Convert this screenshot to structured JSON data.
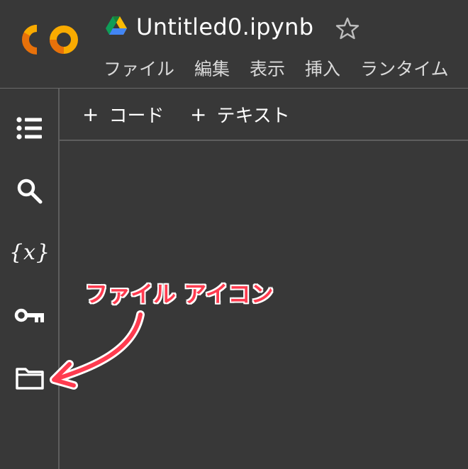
{
  "header": {
    "title": "Untitled0.ipynb",
    "logo_text": "CO",
    "icons": [
      "colab-logo",
      "google-drive-icon",
      "star-icon"
    ],
    "menu": [
      {
        "label": "ファイル"
      },
      {
        "label": "編集"
      },
      {
        "label": "表示"
      },
      {
        "label": "挿入"
      },
      {
        "label": "ランタイム"
      }
    ]
  },
  "toolbar": {
    "add_code_label": "コード",
    "add_text_label": "テキスト",
    "plus_symbol": "+"
  },
  "sidebar": {
    "items": [
      {
        "name": "table-of-contents",
        "icon": "list-icon"
      },
      {
        "name": "search",
        "icon": "search-icon"
      },
      {
        "name": "variables",
        "icon": "variables-icon",
        "glyph": "{x}"
      },
      {
        "name": "secrets",
        "icon": "key-icon"
      },
      {
        "name": "files",
        "icon": "folder-icon"
      }
    ]
  },
  "annotation": {
    "label": "ファイル アイコン",
    "color": "#ff3b4f"
  },
  "colors": {
    "background": "#383838",
    "logo_orange": "#f9ab00",
    "logo_dark_orange": "#e8710a",
    "annotation_red": "#ff3b4f"
  }
}
